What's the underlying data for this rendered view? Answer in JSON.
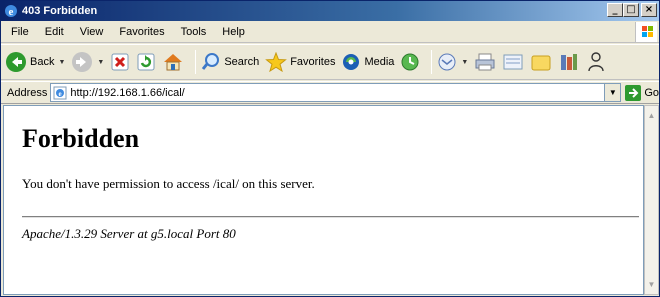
{
  "window": {
    "title": "403 Forbidden",
    "controls": {
      "minimize": "_",
      "maximize": "□",
      "close": "×"
    }
  },
  "menu": [
    "File",
    "Edit",
    "View",
    "Favorites",
    "Tools",
    "Help"
  ],
  "toolbar": {
    "back_label": "Back",
    "search_label": "Search",
    "favorites_label": "Favorites",
    "media_label": "Media"
  },
  "address": {
    "label": "Address",
    "url": "http://192.168.1.66/ical/",
    "go_label": "Go"
  },
  "page": {
    "heading": "Forbidden",
    "message": "You don't have permission to access /ical/ on this server.",
    "server_signature": "Apache/1.3.29 Server at g5.local Port 80"
  },
  "colors": {
    "titlebar_start": "#0a246a",
    "titlebar_end": "#a6caf0",
    "chrome": "#ece9d8",
    "content_bg": "#ffffff"
  }
}
